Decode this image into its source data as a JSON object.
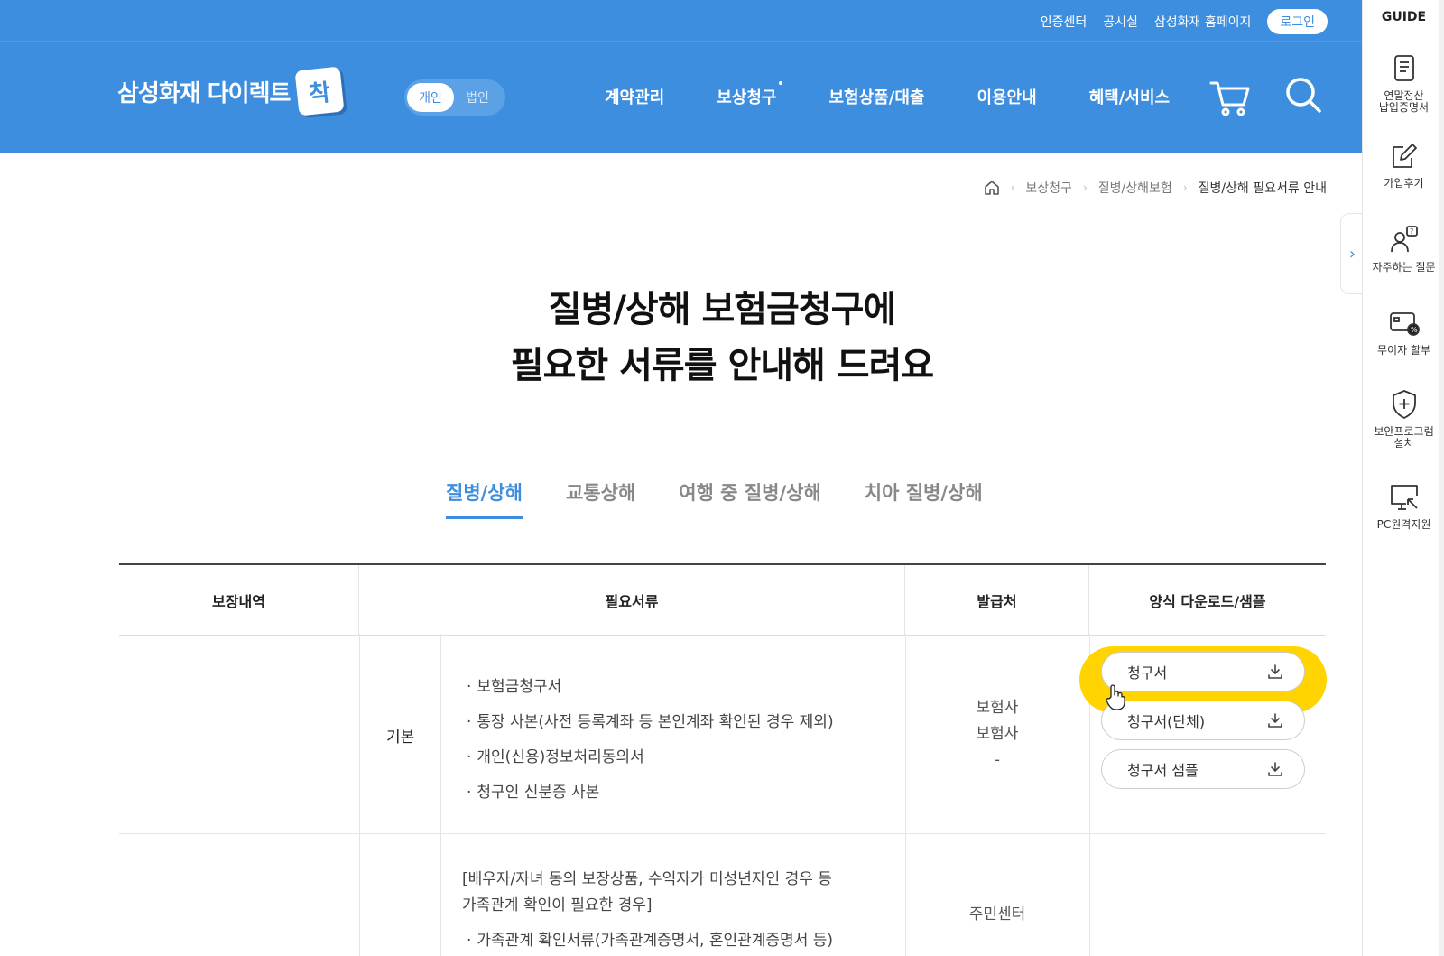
{
  "topbar": {
    "links": [
      "인증센터",
      "공시실",
      "삼성화재 홈페이지"
    ],
    "login_label": "로그인"
  },
  "header": {
    "logo_text": "삼성화재 다이렉트",
    "logo_mark": "착",
    "segment": {
      "on": "개인",
      "off": "법인"
    },
    "nav": [
      "계약관리",
      "보상청구",
      "보험상품/대출",
      "이용안내",
      "혜택/서비스"
    ]
  },
  "breadcrumb": {
    "items": [
      "보상청구",
      "질병/상해보험"
    ],
    "current": "질병/상해 필요서류 안내"
  },
  "page": {
    "title_line1": "질병/상해 보험금청구에",
    "title_line2": "필요한 서류를 안내해 드려요"
  },
  "tabs": [
    "질병/상해",
    "교통상해",
    "여행 중 질병/상해",
    "치아 질병/상해"
  ],
  "table": {
    "headers": [
      "보장내역",
      "필요서류",
      "발급처",
      "양식 다운로드/샘플"
    ],
    "row1": {
      "label": "기본",
      "docs": [
        "보험금청구서",
        "통장 사본(사전 등록계좌 등 본인계좌 확인된 경우 제외)",
        "개인(신용)정보처리동의서",
        "청구인 신분증 사본"
      ],
      "issuers": [
        "보험사",
        "보험사",
        "-"
      ],
      "buttons": [
        "청구서",
        "청구서(단체)",
        "청구서 샘플"
      ]
    },
    "row2": {
      "note_line1": "[배우자/자녀 동의 보장상품, 수익자가 미성년자인 경우 등",
      "note_line2": "가족관계 확인이 필요한 경우]",
      "docs": [
        "가족관계 확인서류(가족관계증명서, 혼인관계증명서 등)"
      ],
      "issuer": "주민센터"
    }
  },
  "side": {
    "guide": "GUIDE",
    "items": [
      {
        "line1": "연말정산",
        "line2": "납입증명서"
      },
      {
        "line1": "가입후기",
        "line2": ""
      },
      {
        "line1": "자주하는 질문",
        "line2": ""
      },
      {
        "line1": "무이자 할부",
        "line2": ""
      },
      {
        "line1": "보안프로그램",
        "line2": "설치"
      },
      {
        "line1": "PC원격지원",
        "line2": ""
      }
    ]
  },
  "colors": {
    "brand": "#3d8ede",
    "highlight": "#ffd400"
  }
}
